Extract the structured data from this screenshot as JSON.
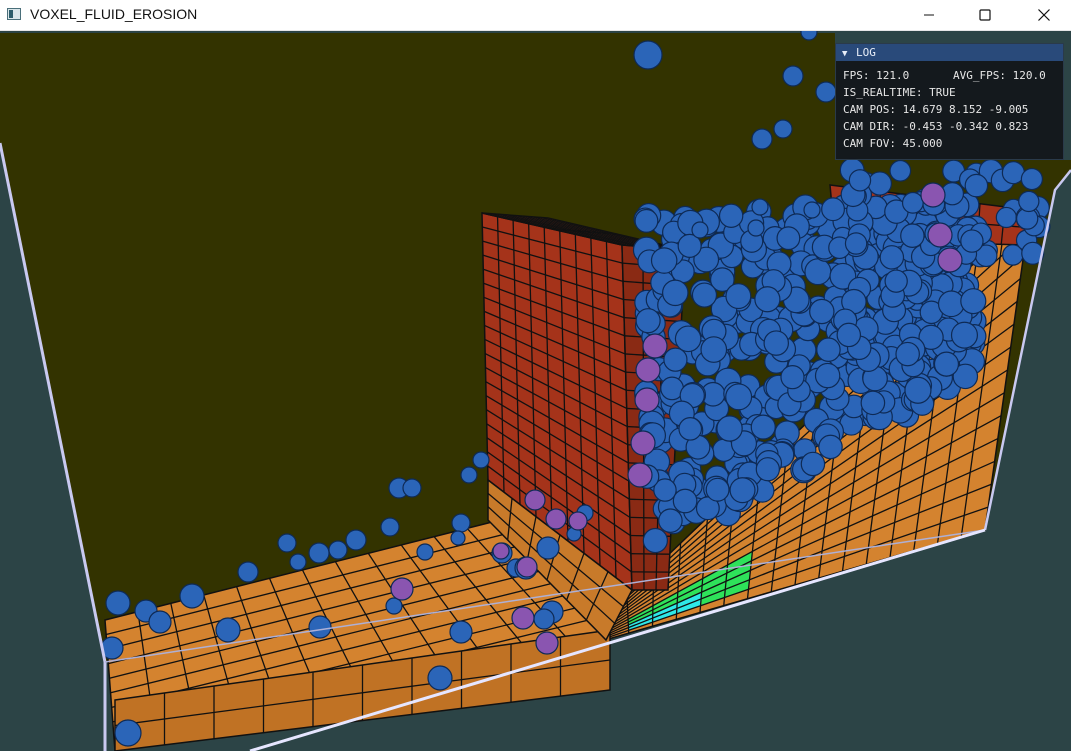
{
  "window": {
    "title": "VOXEL_FLUID_EROSION",
    "icon": "app-window-icon",
    "controls": [
      "minimize-icon",
      "maximize-icon",
      "close-icon"
    ]
  },
  "log": {
    "title": "LOG",
    "fps": "FPS: 121.0",
    "avg_fps": "AVG_FPS: 120.0",
    "is_realtime": "IS_REALTIME: TRUE",
    "cam_pos": "CAM POS: 14.679 8.152 -9.005",
    "cam_dir": "CAM DIR: -0.453 -0.342 0.823",
    "cam_fov": "CAM FOV: 45.000"
  },
  "colors": {
    "background": "#2c4446",
    "back_wall": "#333300",
    "terrain_sand": "#d4832f",
    "terrain_rock": "#a5331a",
    "terrain_green": "#2ee25a",
    "terrain_cyan": "#2ee8e8",
    "fluid_blue": "#2b65b8",
    "fluid_purple": "#8a55b0",
    "log_header": "#294a7a"
  }
}
